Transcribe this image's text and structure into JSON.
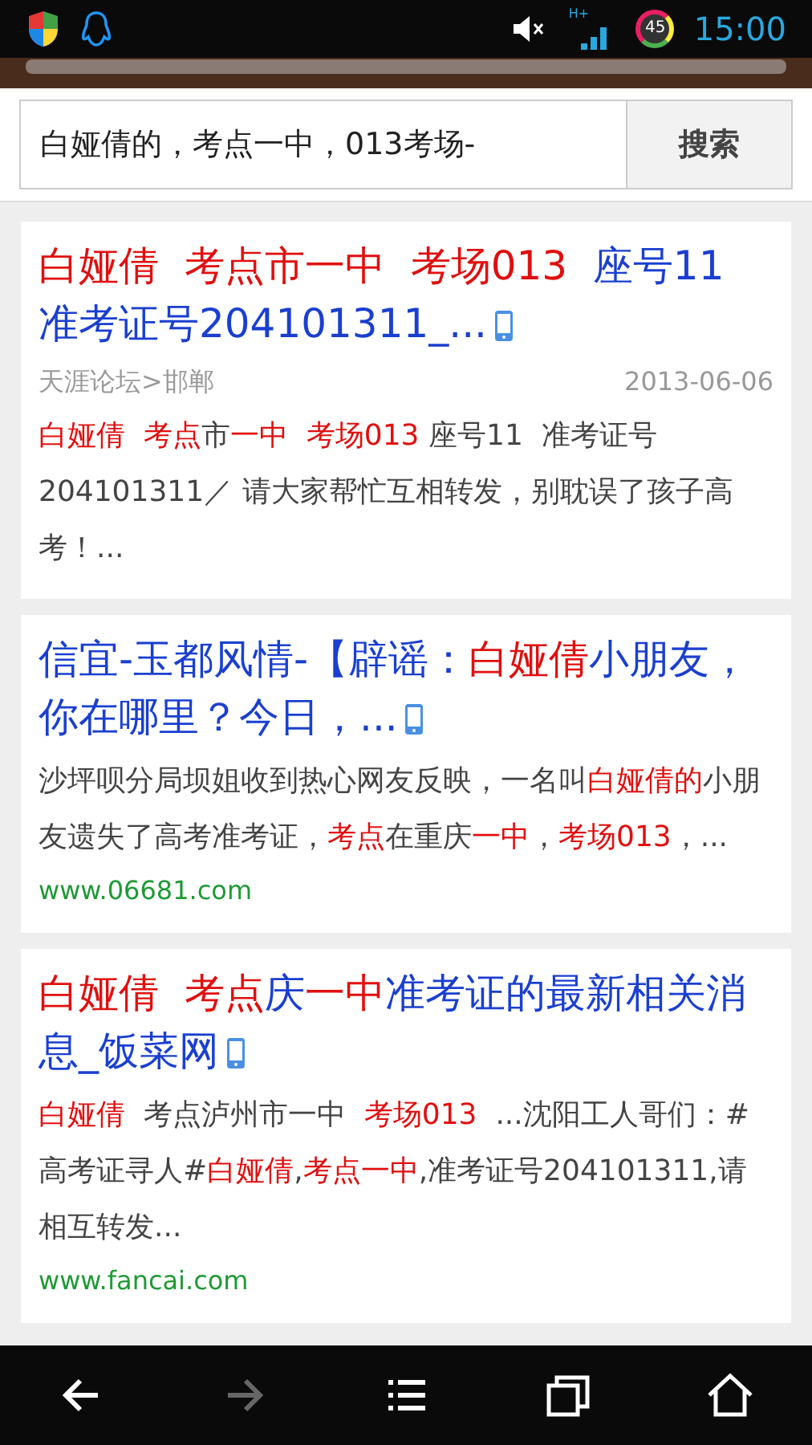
{
  "status_bar": {
    "network": "H+",
    "battery": "45",
    "time": "15:00"
  },
  "search": {
    "value": "白娅倩的，考点一中，013考场-",
    "button": "搜索"
  },
  "results": [
    {
      "title": [
        {
          "text": "白娅倩  ",
          "highlight": true
        },
        {
          "text": "考点市一中  ",
          "highlight": true
        },
        {
          "text": "考场013",
          "highlight": true
        },
        {
          "text": "  座号11 准考证号204101311_...",
          "highlight": false
        }
      ],
      "mobile": true,
      "source": "天涯论坛>邯郸",
      "date": "2013-06-06",
      "snippet": [
        {
          "text": "白娅倩  ",
          "highlight": true
        },
        {
          "text": "考点",
          "highlight": true
        },
        {
          "text": "市",
          "highlight": false
        },
        {
          "text": "一中  ",
          "highlight": true
        },
        {
          "text": "考场013",
          "highlight": true
        },
        {
          "text": " 座号11  准考证号204101311／ 请大家帮忙互相转发，别耽误了孩子高考！...",
          "highlight": false
        }
      ]
    },
    {
      "title": [
        {
          "text": "信宜-玉都风情-【辟谣：",
          "highlight": false
        },
        {
          "text": "白娅倩",
          "highlight": true
        },
        {
          "text": "小朋友，你在哪里？今日，...",
          "highlight": false
        }
      ],
      "mobile": true,
      "snippet": [
        {
          "text": "沙坪呗分局坝姐收到热心网友反映，一名叫",
          "highlight": false
        },
        {
          "text": "白娅倩的",
          "highlight": true
        },
        {
          "text": "小朋友遗失了高考准考证，",
          "highlight": false
        },
        {
          "text": "考点",
          "highlight": true
        },
        {
          "text": "在重庆",
          "highlight": false
        },
        {
          "text": "一中",
          "highlight": true
        },
        {
          "text": "，",
          "highlight": false
        },
        {
          "text": "考场013",
          "highlight": true
        },
        {
          "text": "，...",
          "highlight": false
        }
      ],
      "url": "www.06681.com"
    },
    {
      "title": [
        {
          "text": "白娅倩  ",
          "highlight": true
        },
        {
          "text": "考点",
          "highlight": true
        },
        {
          "text": "庆",
          "highlight": false
        },
        {
          "text": "一中",
          "highlight": true
        },
        {
          "text": "准考证的最新相关消息_饭菜网",
          "highlight": false
        }
      ],
      "mobile": true,
      "snippet": [
        {
          "text": "白娅倩",
          "highlight": true
        },
        {
          "text": "  考点泸州市一中  ",
          "highlight": false
        },
        {
          "text": "考场013",
          "highlight": true
        },
        {
          "text": "  ...沈阳工人哥们：#高考证寻人#",
          "highlight": false
        },
        {
          "text": "白娅倩",
          "highlight": true
        },
        {
          "text": ",",
          "highlight": false
        },
        {
          "text": "考点一中",
          "highlight": true
        },
        {
          "text": ",准考证号204101311,请相互转发...",
          "highlight": false
        }
      ],
      "url": "www.fancai.com"
    }
  ],
  "nav": [
    {
      "kind": "back",
      "disabled": false
    },
    {
      "kind": "forward",
      "disabled": true
    },
    {
      "kind": "menu",
      "disabled": false
    },
    {
      "kind": "windows",
      "disabled": false
    },
    {
      "kind": "home",
      "disabled": false
    }
  ]
}
